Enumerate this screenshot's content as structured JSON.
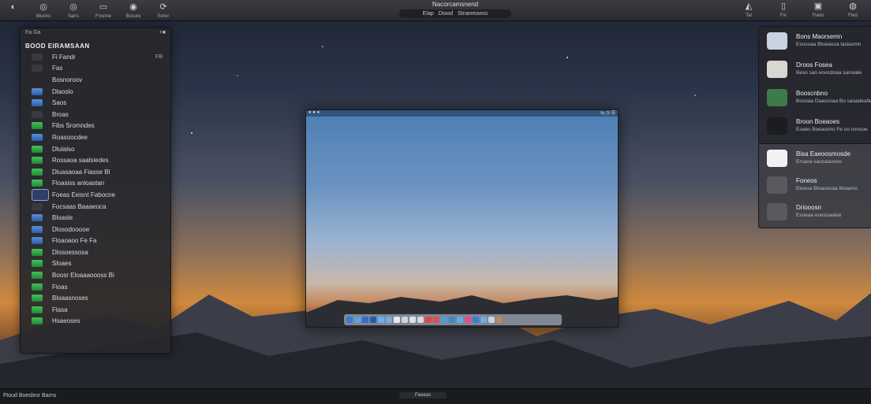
{
  "toolbar": {
    "left_buttons": [
      {
        "glyph": "◐",
        "label": "",
        "icon": "app-icon"
      },
      {
        "glyph": "◎",
        "label": "Bluens",
        "icon": "globe-icon"
      },
      {
        "glyph": "◎",
        "label": "Sarrs",
        "icon": "compass-icon"
      },
      {
        "glyph": "▭",
        "label": "Fosnne",
        "icon": "window-icon"
      },
      {
        "glyph": "◉",
        "label": "Bosure",
        "icon": "target-icon"
      },
      {
        "glyph": "⟳",
        "label": "Sorer",
        "icon": "refresh-icon"
      }
    ],
    "title": "Nacorcamsnend",
    "segments": [
      "Elap",
      "Diood",
      "Stnaneowss"
    ],
    "right_buttons": [
      {
        "glyph": "◭",
        "label": "Tal",
        "icon": "share-icon"
      },
      {
        "glyph": "▯",
        "label": "Fin",
        "icon": "phone-icon"
      },
      {
        "glyph": "▣",
        "label": "Flano",
        "icon": "display-icon"
      },
      {
        "glyph": "◍",
        "label": "Fled",
        "icon": "user-icon"
      }
    ]
  },
  "sidebar": {
    "top_left": "Fa  Ga",
    "top_right": "+■",
    "header": "BOOD  EIRAMSAAN",
    "items": [
      {
        "label": "Fi  Fandr",
        "icon": "dark",
        "extra": "FB"
      },
      {
        "label": "Fas",
        "icon": "dark",
        "extra": ""
      },
      {
        "label": "Bosnoroov",
        "icon": "none",
        "extra": ""
      },
      {
        "label": "Dlaoslo",
        "icon": "blue",
        "extra": ""
      },
      {
        "label": "Saos",
        "icon": "blue",
        "extra": ""
      },
      {
        "label": "Broas",
        "icon": "dark",
        "extra": ""
      },
      {
        "label": "Fibs  Sromndes",
        "icon": "green",
        "extra": ""
      },
      {
        "label": "Roasoocdee",
        "icon": "blue",
        "extra": ""
      },
      {
        "label": "Dlulalso",
        "icon": "green",
        "extra": ""
      },
      {
        "label": "Rossaoa saalsiedes",
        "icon": "green",
        "extra": ""
      },
      {
        "label": "Dluasaoaa  Fiasse  Bl",
        "icon": "green",
        "extra": ""
      },
      {
        "label": "Floasiss anloastan",
        "icon": "green",
        "extra": ""
      },
      {
        "label": "Foeas  Eeisnt Fabocne",
        "icon": "sel",
        "extra": ""
      },
      {
        "label": "Focsaas  Baaaeoca",
        "icon": "dark",
        "extra": ""
      },
      {
        "label": "Bloasle",
        "icon": "blue",
        "extra": ""
      },
      {
        "label": "Dlosodooooe",
        "icon": "blue",
        "extra": ""
      },
      {
        "label": "Floaoaoo  Fe  Fa",
        "icon": "blue",
        "extra": ""
      },
      {
        "label": "Dlosoessosa",
        "icon": "green",
        "extra": ""
      },
      {
        "label": "Sloaes",
        "icon": "green",
        "extra": ""
      },
      {
        "label": "Boosr  Eloaaaoooss  Bi",
        "icon": "green",
        "extra": ""
      },
      {
        "label": "Fioas",
        "icon": "green",
        "extra": ""
      },
      {
        "label": "Bloaasnoses",
        "icon": "green",
        "extra": ""
      },
      {
        "label": "Flasa",
        "icon": "green",
        "extra": ""
      },
      {
        "label": "Hsaeoses",
        "icon": "green",
        "extra": ""
      }
    ]
  },
  "window": {
    "bar_left": "● ● ●",
    "bar_right": "⇆ ◷ ☰"
  },
  "right_panel": {
    "items": [
      {
        "title": "Bons  Maorsemn",
        "subtitle": "Esosoaa Bloeaooa lasiaomn",
        "icon": "finder-icon",
        "color": "#c9d2e0"
      },
      {
        "title": "Droos  Fosea",
        "subtitle": "Beso sao eoocdoaa sansiale",
        "icon": "printer-icon",
        "color": "#d8d8d0"
      },
      {
        "title": "Booscnbno",
        "subtitle": "Bosoaa  Daaccoaa Bu saoadeatle",
        "icon": "monitor-icon",
        "color": "#3f7a4a"
      },
      {
        "title": "Broon  Boeaoes",
        "subtitle": "Eoaes  Boeaoons Fe oo  osnsoe",
        "icon": "clock-icon",
        "color": "#1c1d21"
      }
    ],
    "lower_items": [
      {
        "title": "Bisa  Eaeoosmosde",
        "subtitle": "Ercaoa saosaaoooo",
        "icon": "photos-icon",
        "color": "#f2f2f4"
      },
      {
        "title": "Foneos",
        "subtitle": "Eloeoa  Bloaceoaa bloaeno",
        "icon": "heart-icon",
        "color": "#5a5a5e"
      },
      {
        "title": "Driooosn",
        "subtitle": "Esoeaa eoesoaalee",
        "icon": "keyboard-icon",
        "color": "#5a5a5e"
      }
    ]
  },
  "status": {
    "left": "Ftoud  Boeslesr  Barns",
    "mid": "Faoeas"
  }
}
